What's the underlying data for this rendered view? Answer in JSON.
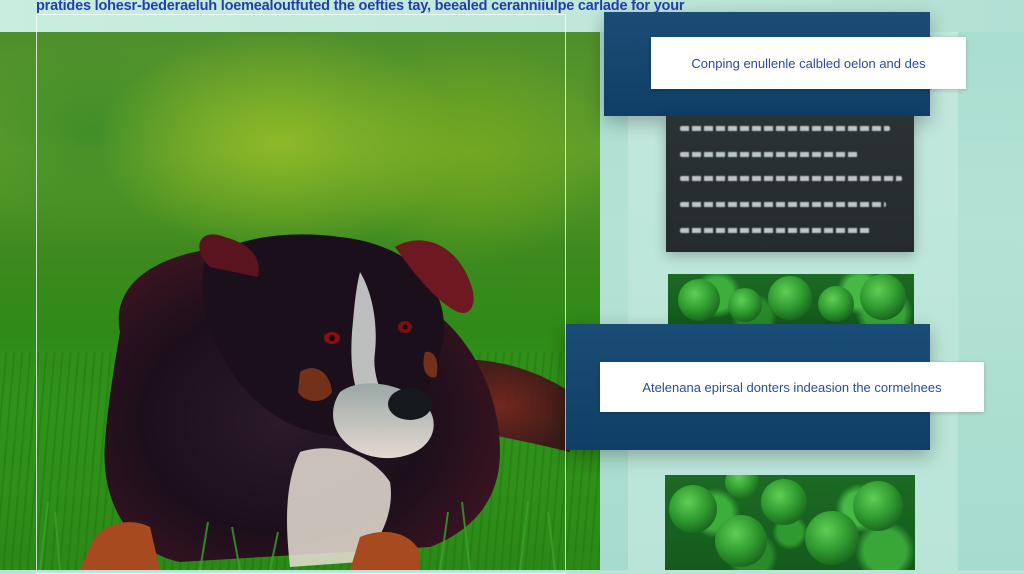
{
  "top_caption": "pratides lohesr-bederaeluh loemealoutfuted the oefties tay, beealed ceranniiulpe carlade for your",
  "card_top": {
    "label": "Conping enullenle calbled oelon and des"
  },
  "card_middle": {
    "label": "Atelenana epirsal donters indeasion the cormelnees"
  },
  "colors": {
    "navy_card": "#113f68",
    "label_text": "#2a4c9c",
    "caption_text": "#1f3fae",
    "background_mint": "#b9e3d8"
  },
  "icons": {
    "photo": "dog-in-grass-photo",
    "moss_top": "moss-thumbnail",
    "moss_bottom": "moss-thumbnail"
  }
}
